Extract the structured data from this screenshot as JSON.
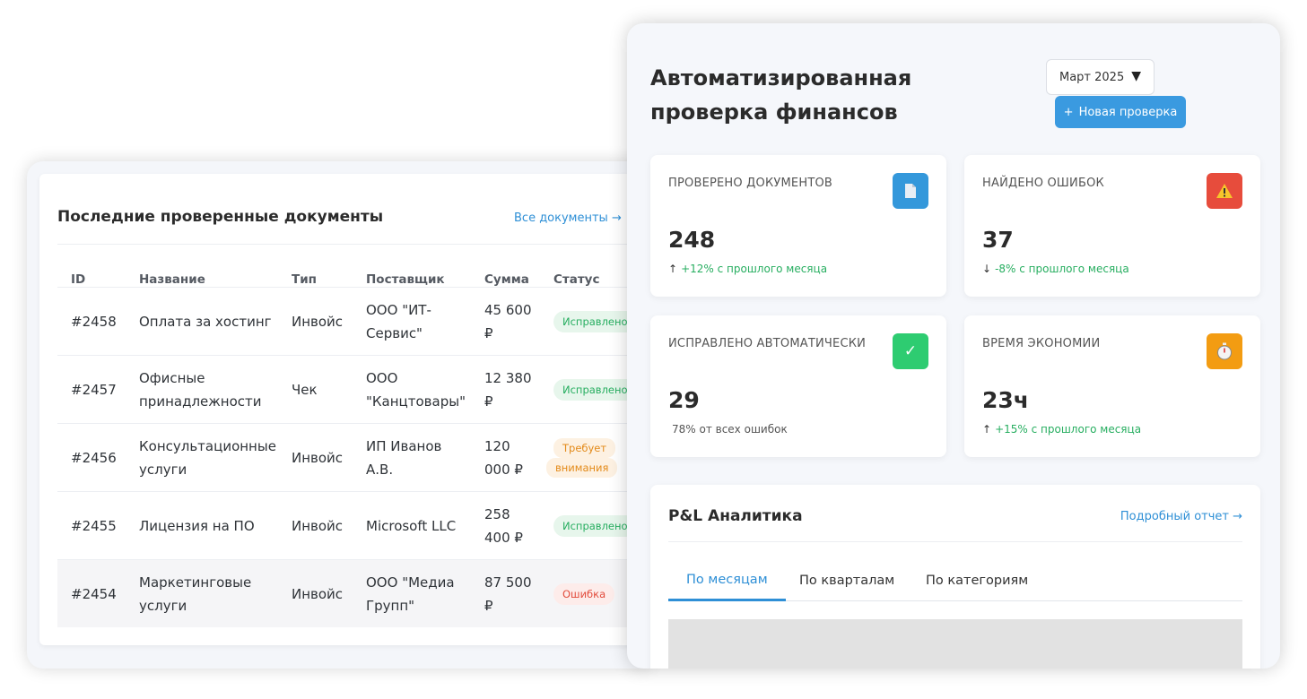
{
  "documents": {
    "title": "Последние проверенные документы",
    "all_link": "Все документы →",
    "columns": [
      "ID",
      "Название",
      "Тип",
      "Поставщик",
      "Сумма",
      "Статус"
    ],
    "rows": [
      {
        "id": "#2458",
        "name": "Оплата за хостинг",
        "type": "Инвойс",
        "vendor": "ООО \"ИТ-Сервис\"",
        "amount": "45 600 ₽",
        "status": "Исправлено"
      },
      {
        "id": "#2457",
        "name": "Офисные принадлежности",
        "type": "Чек",
        "vendor": "ООО \"Канцтовары\"",
        "amount": "12 380 ₽",
        "status": "Исправлено"
      },
      {
        "id": "#2456",
        "name": "Консультационные услуги",
        "type": "Инвойс",
        "vendor": "ИП Иванов А.В.",
        "amount": "120 000 ₽",
        "status_line1": "Требует",
        "status_line2": "внимания"
      },
      {
        "id": "#2455",
        "name": "Лицензия на ПО",
        "type": "Инвойс",
        "vendor": "Microsoft LLC",
        "amount": "258 400 ₽",
        "status": "Исправлено"
      },
      {
        "id": "#2454",
        "name": "Маркетинговые услуги",
        "type": "Инвойс",
        "vendor": "ООО \"Медиа Групп\"",
        "amount": "87 500 ₽",
        "status": "Ошибка"
      }
    ]
  },
  "dashboard": {
    "title": "Автоматизированная проверка финансов",
    "month": "Март 2025",
    "new_check_label": "Новая проверка",
    "stats": [
      {
        "label": "ПРОВЕРЕНО ДОКУМЕНТОВ",
        "value": "248",
        "arrow": "↑",
        "sub": "+12% с прошлого месяца",
        "icon": "document-icon",
        "color": "#3498db"
      },
      {
        "label": "НАЙДЕНО ОШИБОК",
        "value": "37",
        "arrow": "↓",
        "sub": "-8% с прошлого месяца",
        "icon": "warning-icon",
        "color": "#e74c3c"
      },
      {
        "label": "ИСПРАВЛЕНО АВТОМАТИЧЕСКИ",
        "value": "29",
        "sub": "78% от всех ошибок",
        "icon": "check-icon",
        "color": "#2ecc71"
      },
      {
        "label": "ВРЕМЯ ЭКОНОМИИ",
        "value": "23ч",
        "arrow": "↑",
        "sub": "+15% с прошлого месяца",
        "icon": "stopwatch-icon",
        "color": "#f39c12"
      }
    ],
    "pl": {
      "title": "P&L Аналитика",
      "link": "Подробный отчет →",
      "tabs": [
        "По месяцам",
        "По кварталам",
        "По категориям"
      ]
    }
  },
  "colors": {
    "accent": "#3a9ae0",
    "ok": "#27ae60",
    "warn": "#e38a19",
    "error": "#e24c3c"
  }
}
